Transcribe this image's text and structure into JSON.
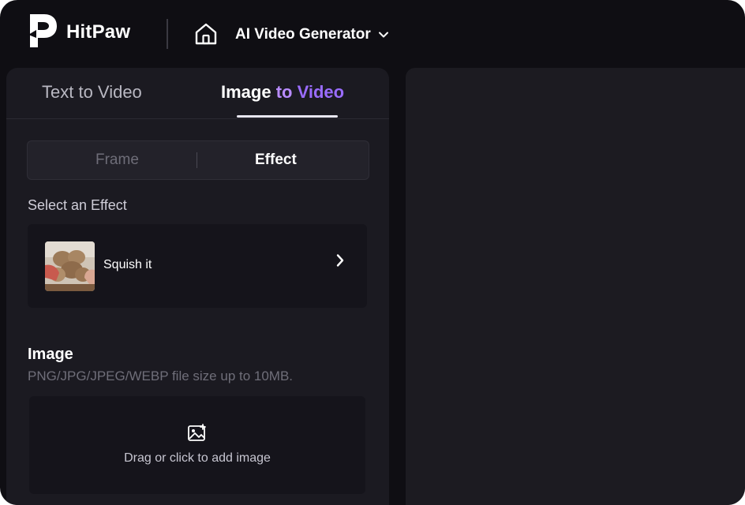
{
  "header": {
    "brand": "HitPaw",
    "product": "AI Video Generator",
    "icons": {
      "logo": "hitpaw-logo",
      "home": "home-icon",
      "dropdown": "chevron-down-icon"
    }
  },
  "tabs": {
    "text_to_video": "Text to Video",
    "image_to_video": {
      "part1": "Image",
      "part2": "to",
      "part3": "Video"
    },
    "active": "image_to_video"
  },
  "segmented": {
    "frame": "Frame",
    "effect": "Effect",
    "selected": "effect"
  },
  "effect_section": {
    "label": "Select an Effect",
    "selected_effect": "Squish it"
  },
  "image_section": {
    "title": "Image",
    "hint": "PNG/JPG/JPEG/WEBP file size up to 10MB.",
    "dropzone_text": "Drag or click to add image"
  },
  "colors": {
    "background": "#0f0e13",
    "panel": "#1b1a21",
    "accent_light": "#b98cff",
    "accent": "#9a6cff"
  }
}
